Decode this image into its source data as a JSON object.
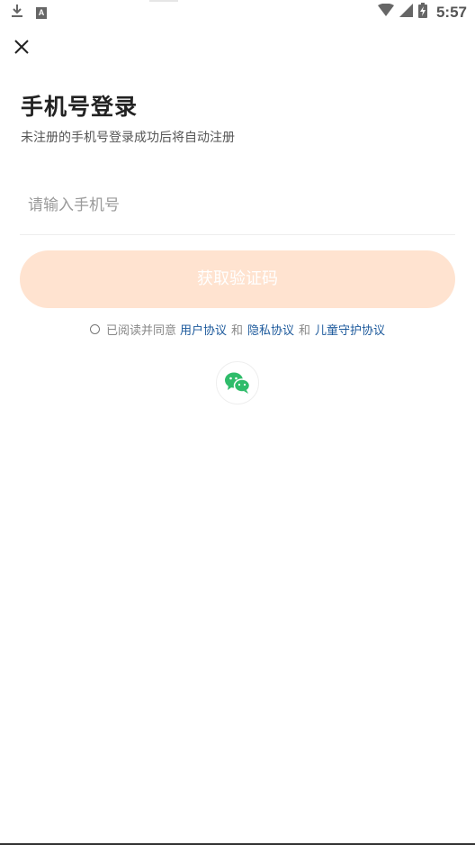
{
  "status_bar": {
    "time": "5:57",
    "icons": [
      "download-icon",
      "a-notification-icon",
      "wifi-icon",
      "signal-icon",
      "battery-charging-icon"
    ]
  },
  "header": {
    "close_icon": "close-icon"
  },
  "login": {
    "title": "手机号登录",
    "subtitle": "未注册的手机号登录成功后将自动注册",
    "phone_placeholder": "请输入手机号",
    "phone_value": "",
    "get_code_label": "获取验证码",
    "get_code_button_color": "#ffe3d0"
  },
  "agreement": {
    "prefix": "已阅读并同意",
    "user_agreement": "用户协议",
    "and_1": "和",
    "privacy_policy": "隐私协议",
    "and_2": "和",
    "child_protection": "儿童守护协议",
    "checked": false,
    "link_color": "#1d5a9c"
  },
  "third_party": {
    "wechat_icon": "wechat-icon",
    "wechat_color": "#2fbc6a"
  }
}
